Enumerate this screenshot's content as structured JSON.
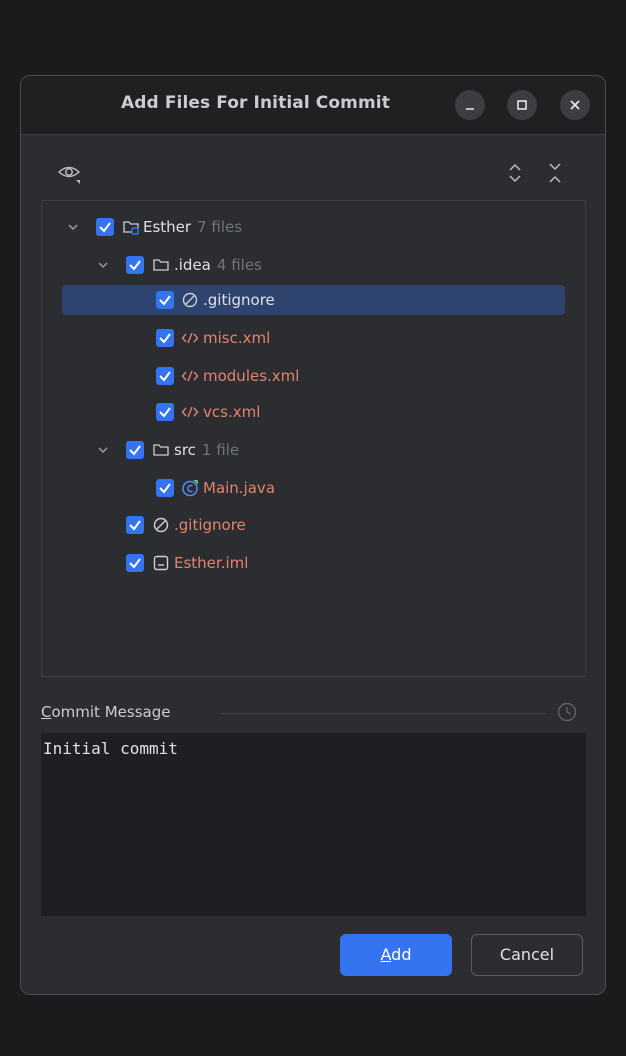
{
  "dialog": {
    "title": "Add Files For Initial Commit",
    "window_buttons": {
      "minimize": "minimize",
      "maximize": "maximize",
      "close": "close"
    }
  },
  "toolbar": {
    "view_icon": "eye-icon",
    "expand_icon": "expand-all-icon",
    "collapse_icon": "collapse-all-icon"
  },
  "tree": {
    "root": {
      "name": "Esther",
      "count": "7 files"
    },
    "idea": {
      "name": ".idea",
      "count": "4 files"
    },
    "idea_gitignore": {
      "name": ".gitignore"
    },
    "misc": {
      "name": "misc.xml"
    },
    "modules": {
      "name": "modules.xml"
    },
    "vcs": {
      "name": "vcs.xml"
    },
    "src": {
      "name": "src",
      "count": "1 file"
    },
    "main": {
      "name": "Main.java"
    },
    "root_gitignore": {
      "name": ".gitignore"
    },
    "iml": {
      "name": "Esther.iml"
    }
  },
  "commit": {
    "label_mnemonic": "C",
    "label_rest": "ommit Message",
    "message": "Initial commit"
  },
  "buttons": {
    "add_mnemonic": "A",
    "add_rest": "dd",
    "cancel": "Cancel"
  },
  "colors": {
    "accent": "#3574f0",
    "selection": "#2e436e",
    "unversioned_file": "#e5826f",
    "count_text": "#6f737a"
  }
}
